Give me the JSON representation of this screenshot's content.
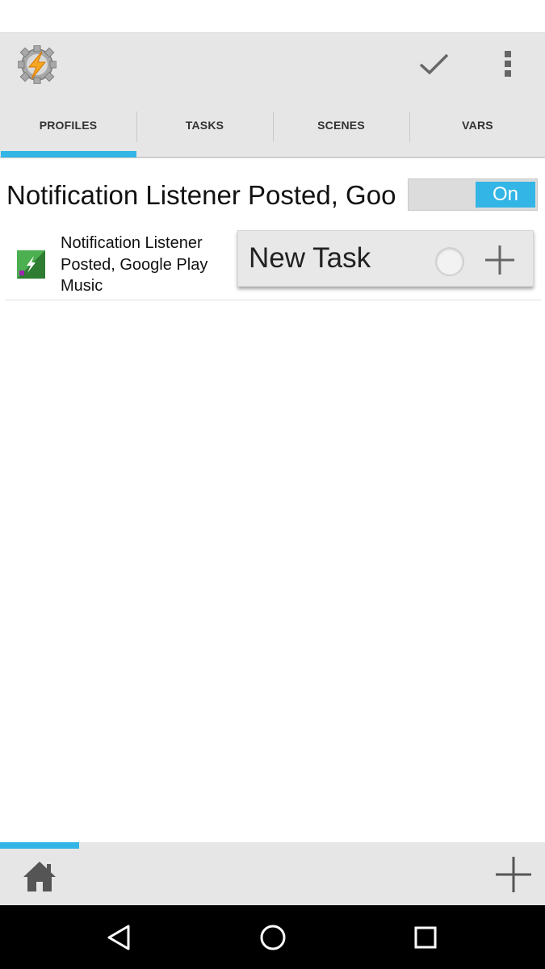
{
  "colors": {
    "accent": "#33b5e5",
    "bar_bg": "#e6e6e6",
    "nav_bg": "#000000"
  },
  "actionbar": {
    "logo_icon": "tasker-gear-bolt-icon",
    "check_icon": "check-icon",
    "more_icon": "overflow-menu-icon"
  },
  "tabs": [
    {
      "label": "PROFILES",
      "selected": true
    },
    {
      "label": "TASKS",
      "selected": false
    },
    {
      "label": "SCENES",
      "selected": false
    },
    {
      "label": "VARS",
      "selected": false
    }
  ],
  "profile": {
    "title": "Notification Listener Posted, Google Play Music",
    "toggle_label": "On",
    "context_icon": "event-bolt-icon",
    "context_label": "Notification Listener Posted, Google Play Music"
  },
  "new_task": {
    "label": "New Task",
    "radio_icon": "radio-button-icon",
    "add_icon": "plus-icon"
  },
  "bottombar": {
    "home_icon": "home-icon",
    "add_icon": "plus-icon"
  },
  "navbar": {
    "back_icon": "back-triangle-icon",
    "home_icon": "home-circle-icon",
    "recents_icon": "recents-square-icon"
  }
}
